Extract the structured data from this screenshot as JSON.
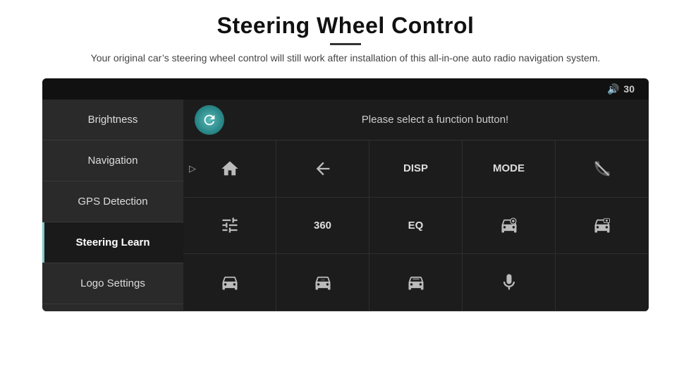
{
  "header": {
    "title": "Steering Wheel Control",
    "subtitle": "Your original car’s steering wheel control will still work after installation of this all-in-one auto radio navigation system.",
    "divider": true
  },
  "topbar": {
    "volume_icon": "🔊",
    "volume_value": "30"
  },
  "sidebar": {
    "items": [
      {
        "id": "brightness",
        "label": "Brightness",
        "active": false
      },
      {
        "id": "navigation",
        "label": "Navigation",
        "active": false
      },
      {
        "id": "gps-detection",
        "label": "GPS Detection",
        "active": false
      },
      {
        "id": "steering-learn",
        "label": "Steering Learn",
        "active": true
      },
      {
        "id": "logo-settings",
        "label": "Logo Settings",
        "active": false
      }
    ]
  },
  "function_bar": {
    "prompt": "Please select a function button!"
  },
  "grid": {
    "cells": [
      {
        "id": "home",
        "type": "icon",
        "icon": "home"
      },
      {
        "id": "back",
        "type": "icon",
        "icon": "back"
      },
      {
        "id": "disp",
        "type": "label",
        "label": "DISP"
      },
      {
        "id": "mode",
        "type": "label",
        "label": "MODE"
      },
      {
        "id": "phone-no",
        "type": "icon",
        "icon": "phone-cancel"
      },
      {
        "id": "tune",
        "type": "icon",
        "icon": "tune"
      },
      {
        "id": "360",
        "type": "label",
        "label": "360"
      },
      {
        "id": "eq",
        "type": "label",
        "label": "EQ"
      },
      {
        "id": "car-cam1",
        "type": "icon",
        "icon": "car-cam1"
      },
      {
        "id": "car-cam2",
        "type": "icon",
        "icon": "car-cam2"
      },
      {
        "id": "car-front",
        "type": "icon",
        "icon": "car-front"
      },
      {
        "id": "car-side",
        "type": "icon",
        "icon": "car-side"
      },
      {
        "id": "car-back",
        "type": "icon",
        "icon": "car-back"
      },
      {
        "id": "mic",
        "type": "icon",
        "icon": "mic"
      },
      {
        "id": "empty",
        "type": "empty",
        "label": ""
      }
    ]
  }
}
